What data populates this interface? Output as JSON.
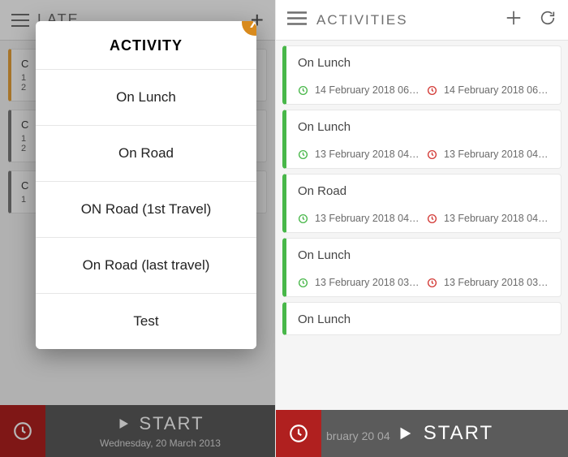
{
  "left": {
    "header_title": "LATE",
    "bg_cards": [
      {
        "title": "C",
        "line1": "1",
        "line2": "2"
      },
      {
        "title": "C",
        "line1": "1",
        "line2": "2"
      },
      {
        "title": "C",
        "line1": "1",
        "line2": ""
      }
    ],
    "start_label": "START",
    "sub_date": "Wednesday, 20 March 2013"
  },
  "modal": {
    "title": "ACTIVITY",
    "close_label": "X",
    "options": [
      "On Lunch",
      "On Road",
      "ON Road (1st Travel)",
      "On Road (last travel)",
      "Test"
    ]
  },
  "right": {
    "header_title": "ACTIVITIES",
    "cards": [
      {
        "title": "On Lunch",
        "start": "14 February 2018 06…",
        "end": "14 February 2018 06…"
      },
      {
        "title": "On Lunch",
        "start": "13 February 2018 04…",
        "end": "13 February 2018 04…"
      },
      {
        "title": "On Road",
        "start": "13 February 2018 04…",
        "end": "13 February 2018 04…"
      },
      {
        "title": "On Lunch",
        "start": "13 February 2018 03…",
        "end": "13 February 2018 03…"
      },
      {
        "title": "On Lunch",
        "start": "",
        "end": ""
      }
    ],
    "start_label": "START",
    "bg_date": "bruary 20    04"
  },
  "colors": {
    "accent_green": "#48b749",
    "accent_red": "#d33a36",
    "badge_red": "#b0201f",
    "close_btn": "#d88a1d"
  }
}
